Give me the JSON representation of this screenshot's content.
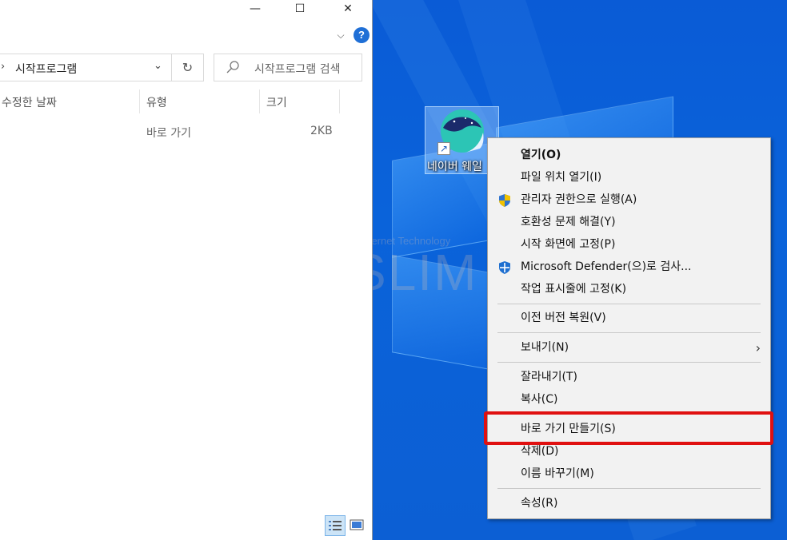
{
  "explorer": {
    "address_path": "시작프로그램",
    "search_placeholder": "시작프로그램 검색",
    "columns": [
      "수정한 날짜",
      "유형",
      "크기"
    ],
    "row": {
      "type": "바로 가기",
      "size": "2KB"
    },
    "window_controls": {
      "minimize": "—",
      "maximize": "☐",
      "close": "✕"
    },
    "help_glyph": "?"
  },
  "desktop": {
    "icon_label": "네이버 웨일",
    "watermark_text": "SLIM",
    "watermark_subtitle": "Internet Technology"
  },
  "context_menu": {
    "items": [
      {
        "label": "열기(O)",
        "icon": ""
      },
      {
        "label": "파일 위치 열기(I)",
        "icon": ""
      },
      {
        "label": "관리자 권한으로 실행(A)",
        "icon": "uac-shield-icon"
      },
      {
        "label": "호환성 문제 해결(Y)",
        "icon": ""
      },
      {
        "label": "시작 화면에 고정(P)",
        "icon": ""
      },
      {
        "label": "Microsoft Defender(으)로 검사...",
        "icon": "defender-icon"
      },
      {
        "label": "작업 표시줄에 고정(K)",
        "icon": ""
      },
      {
        "label": "이전 버전 복원(V)",
        "icon": ""
      },
      {
        "label": "보내기(N)",
        "icon": ""
      },
      {
        "label": "잘라내기(T)",
        "icon": ""
      },
      {
        "label": "복사(C)",
        "icon": ""
      },
      {
        "label": "바로 가기 만들기(S)",
        "icon": ""
      },
      {
        "label": "삭제(D)",
        "icon": ""
      },
      {
        "label": "이름 바꾸기(M)",
        "icon": ""
      },
      {
        "label": "속성(R)",
        "icon": ""
      }
    ],
    "submenu_arrow": "›"
  },
  "colors": {
    "highlight_border": "#e01010",
    "desktop_blue": "#0a5bd6",
    "menu_bg": "#f2f2f2"
  }
}
